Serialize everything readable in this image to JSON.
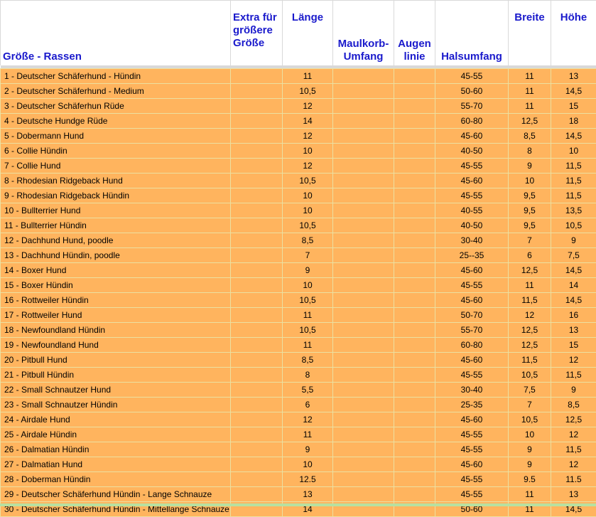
{
  "headers": {
    "name": "Größe - Rassen",
    "extra": "Extra für größere Größe",
    "laenge": "Länge",
    "maulkorb": "Maulkorb-Umfang",
    "augen": "Augen linie",
    "hals": "Halsumfang",
    "breite": "Breite",
    "hoehe": "Höhe"
  },
  "rows": [
    {
      "name": "1 - Deutscher Schäferhund - Hündin",
      "extra": "",
      "laenge": "11",
      "maulkorb": "",
      "augen": "",
      "hals": "45-55",
      "breite": "11",
      "hoehe": "13"
    },
    {
      "name": "2 - Deutscher Schäferhund - Medium",
      "extra": "",
      "laenge": "10,5",
      "maulkorb": "",
      "augen": "",
      "hals": "50-60",
      "breite": "11",
      "hoehe": "14,5"
    },
    {
      "name": "3 - Deutscher Schäferhun Rüde",
      "extra": "",
      "laenge": "12",
      "maulkorb": "",
      "augen": "",
      "hals": "55-70",
      "breite": "11",
      "hoehe": "15"
    },
    {
      "name": "4 - Deutsche Hundge Rüde",
      "extra": "",
      "laenge": "14",
      "maulkorb": "",
      "augen": "",
      "hals": "60-80",
      "breite": "12,5",
      "hoehe": "18"
    },
    {
      "name": "5 - Dobermann Hund",
      "extra": "",
      "laenge": "12",
      "maulkorb": "",
      "augen": "",
      "hals": "45-60",
      "breite": "8,5",
      "hoehe": "14,5"
    },
    {
      "name": "6 - Collie Hündin",
      "extra": "",
      "laenge": "10",
      "maulkorb": "",
      "augen": "",
      "hals": "40-50",
      "breite": "8",
      "hoehe": "10"
    },
    {
      "name": "7 - Collie Hund",
      "extra": "",
      "laenge": "12",
      "maulkorb": "",
      "augen": "",
      "hals": "45-55",
      "breite": "9",
      "hoehe": "11,5"
    },
    {
      "name": "8 - Rhodesian Ridgeback Hund",
      "extra": "",
      "laenge": "10,5",
      "maulkorb": "",
      "augen": "",
      "hals": "45-60",
      "breite": "10",
      "hoehe": "11,5"
    },
    {
      "name": "9 - Rhodesian Ridgeback Hündin",
      "extra": "",
      "laenge": "10",
      "maulkorb": "",
      "augen": "",
      "hals": "45-55",
      "breite": "9,5",
      "hoehe": "11,5"
    },
    {
      "name": "10 - Bullterrier Hund",
      "extra": "",
      "laenge": "10",
      "maulkorb": "",
      "augen": "",
      "hals": "40-55",
      "breite": "9,5",
      "hoehe": "13,5"
    },
    {
      "name": "11 - Bullterrier Hündin",
      "extra": "",
      "laenge": "10,5",
      "maulkorb": "",
      "augen": "",
      "hals": "40-50",
      "breite": "9,5",
      "hoehe": "10,5"
    },
    {
      "name": "12 - Dachhund Hund, poodle",
      "extra": "",
      "laenge": "8,5",
      "maulkorb": "",
      "augen": "",
      "hals": "30-40",
      "breite": "7",
      "hoehe": "9"
    },
    {
      "name": "13 - Dachhund Hündin, poodle",
      "extra": "",
      "laenge": "7",
      "maulkorb": "",
      "augen": "",
      "hals": "25--35",
      "breite": "6",
      "hoehe": "7,5"
    },
    {
      "name": "14 - Boxer Hund",
      "extra": "",
      "laenge": "9",
      "maulkorb": "",
      "augen": "",
      "hals": "45-60",
      "breite": "12,5",
      "hoehe": "14,5"
    },
    {
      "name": "15 - Boxer Hündin",
      "extra": "",
      "laenge": "10",
      "maulkorb": "",
      "augen": "",
      "hals": "45-55",
      "breite": "11",
      "hoehe": "14"
    },
    {
      "name": "16 - Rottweiler Hündin",
      "extra": "",
      "laenge": "10,5",
      "maulkorb": "",
      "augen": "",
      "hals": "45-60",
      "breite": "11,5",
      "hoehe": "14,5"
    },
    {
      "name": "17 - Rottweiler Hund",
      "extra": "",
      "laenge": "11",
      "maulkorb": "",
      "augen": "",
      "hals": "50-70",
      "breite": "12",
      "hoehe": "16"
    },
    {
      "name": "18 - Newfoundland Hündin",
      "extra": "",
      "laenge": "10,5",
      "maulkorb": "",
      "augen": "",
      "hals": "55-70",
      "breite": "12,5",
      "hoehe": "13"
    },
    {
      "name": "19 - Newfoundland Hund",
      "extra": "",
      "laenge": "11",
      "maulkorb": "",
      "augen": "",
      "hals": "60-80",
      "breite": "12,5",
      "hoehe": "15"
    },
    {
      "name": "20 - Pitbull Hund",
      "extra": "",
      "laenge": "8,5",
      "maulkorb": "",
      "augen": "",
      "hals": "45-60",
      "breite": "11,5",
      "hoehe": "12"
    },
    {
      "name": "21 - Pitbull Hündin",
      "extra": "",
      "laenge": "8",
      "maulkorb": "",
      "augen": "",
      "hals": "45-55",
      "breite": "10,5",
      "hoehe": "11,5"
    },
    {
      "name": "22 - Small Schnautzer Hund",
      "extra": "",
      "laenge": "5,5",
      "maulkorb": "",
      "augen": "",
      "hals": "30-40",
      "breite": "7,5",
      "hoehe": "9"
    },
    {
      "name": "23 - Small Schnautzer Hündin",
      "extra": "",
      "laenge": "6",
      "maulkorb": "",
      "augen": "",
      "hals": "25-35",
      "breite": "7",
      "hoehe": "8,5"
    },
    {
      "name": "24 - Airdale Hund",
      "extra": "",
      "laenge": "12",
      "maulkorb": "",
      "augen": "",
      "hals": "45-60",
      "breite": "10,5",
      "hoehe": "12,5"
    },
    {
      "name": "25 - Airdale Hündin",
      "extra": "",
      "laenge": "11",
      "maulkorb": "",
      "augen": "",
      "hals": "45-55",
      "breite": "10",
      "hoehe": "12"
    },
    {
      "name": "26 - Dalmatian Hündin",
      "extra": "",
      "laenge": "9",
      "maulkorb": "",
      "augen": "",
      "hals": "45-55",
      "breite": "9",
      "hoehe": "11,5"
    },
    {
      "name": "27 - Dalmatian Hund",
      "extra": "",
      "laenge": "10",
      "maulkorb": "",
      "augen": "",
      "hals": "45-60",
      "breite": "9",
      "hoehe": "12"
    },
    {
      "name": "28 - Doberman Hündin",
      "extra": "",
      "laenge": "12.5",
      "maulkorb": "",
      "augen": "",
      "hals": "45-55",
      "breite": "9.5",
      "hoehe": "11.5"
    },
    {
      "name": "29 - Deutscher Schäferhund Hündin - Lange Schnauze",
      "extra": "",
      "laenge": "13",
      "maulkorb": "",
      "augen": "",
      "hals": "45-55",
      "breite": "11",
      "hoehe": "13"
    },
    {
      "name": "30 - Deutscher Schäferhund Hündin - Mittellange Schnauze",
      "extra": "",
      "laenge": "14",
      "maulkorb": "",
      "augen": "",
      "hals": "50-60",
      "breite": "11",
      "hoehe": "14,5"
    }
  ],
  "colors": {
    "row_fill": "#ffb45e",
    "header_text": "#1a1acc",
    "grid_line": "#ece0a0"
  }
}
